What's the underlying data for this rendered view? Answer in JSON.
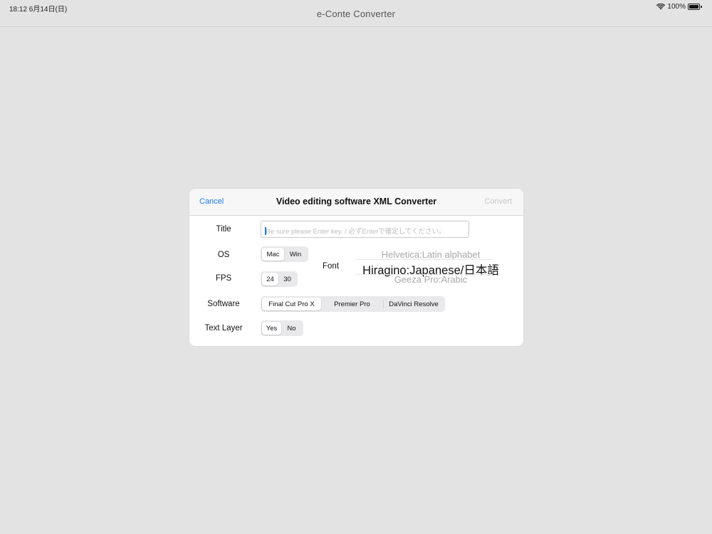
{
  "status": {
    "time_date": "18:12  6月14日(日)",
    "battery": "100%"
  },
  "nav": {
    "title": "e-Conte Converter"
  },
  "sheet": {
    "cancel": "Cancel",
    "title": "Video editing software XML Converter",
    "convert": "Convert",
    "title_label": "Title",
    "title_placeholder": "Be sure please Enter key. / 必ずEnterで確定してください。",
    "os_label": "OS",
    "os_options": [
      "Mac",
      "Win"
    ],
    "os_selected": "Mac",
    "fps_label": "FPS",
    "fps_options": [
      "24",
      "30"
    ],
    "fps_selected": "24",
    "font_label": "Font",
    "font_options": [
      "Helvetica:Latin alphabet",
      "Hiragino:Japanese/日本語",
      "Geeza Pro:Arabic"
    ],
    "font_selected": "Hiragino:Japanese/日本語",
    "software_label": "Software",
    "software_options": [
      "Final Cut Pro X",
      "Premier Pro",
      "DaVinci Resolve"
    ],
    "software_selected": "Final Cut Pro X",
    "text_layer_label": "Text Layer",
    "text_layer_options": [
      "Yes",
      "No"
    ],
    "text_layer_selected": "Yes"
  },
  "colors": {
    "accent": "#1a7cf0",
    "background": "#e3e3e3",
    "disabled": "#c7c7c7"
  },
  "icons": {
    "wifi": "wifi-icon",
    "battery": "battery-icon"
  }
}
